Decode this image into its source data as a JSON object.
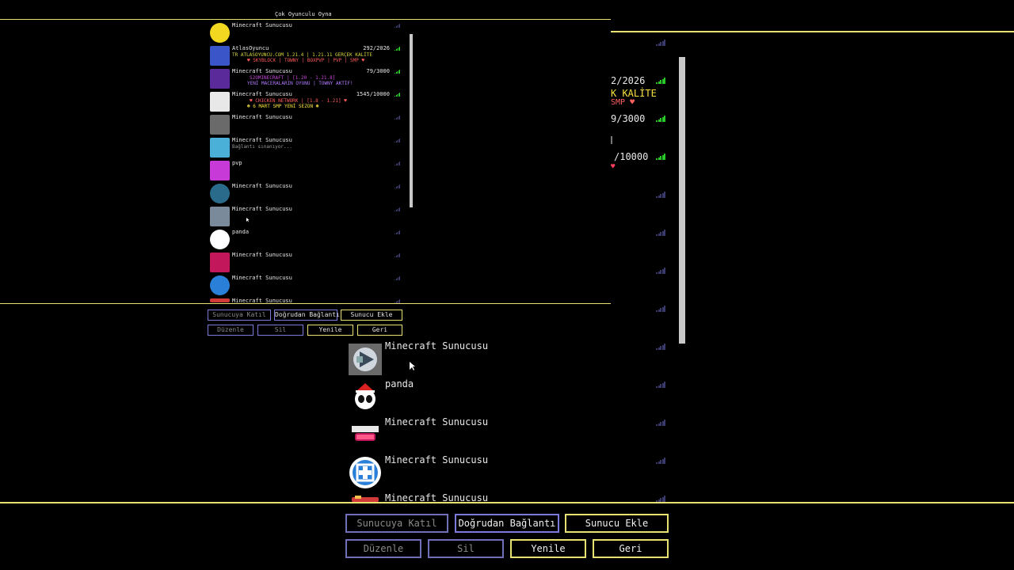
{
  "screen_title": "Çok Oyunculu Oyna",
  "servers": [
    {
      "name": "Minecraft Sunucusu",
      "icon": "yellow-face-icon"
    },
    {
      "name": "AtlasOyuncu",
      "icon": "atlas-shield-icon",
      "players": "292/2026",
      "signal": "green",
      "motd1": "TR ATLASOYUNCU.COM 1.21.4 | 1.21.11 GERÇEK KALİTE",
      "motd2": "♥ SKYBLOCK | TOWNY | BOXPVP | PVP | SMP ♥"
    },
    {
      "name": "Minecraft Sunucusu",
      "icon": "purple-mask-icon",
      "players": "79/3000",
      "signal": "green",
      "motd1": "S2OMINECRAFT | [1.20 - 1.21.8]",
      "motd2": "YENİ MACERALARIN OYUNU | TOWNY AKTİF!"
    },
    {
      "name": "Minecraft Sunucusu",
      "icon": "chicken-icon",
      "players": "1545/10000",
      "signal": "green",
      "motd1": "♥ CHICKEN NETWORK | [1.8 - 1.21] ♥",
      "motd2": "☻ 6 MART SMP YENİ SEZON ☻"
    },
    {
      "name": "Minecraft Sunucusu",
      "icon": "landscape-icon"
    },
    {
      "name": "Minecraft Sunucusu",
      "icon": "dragon-icon",
      "motd1": "Bağlantı sınanıyor..."
    },
    {
      "name": "pvp",
      "icon": "pvp-logo-icon"
    },
    {
      "name": "Minecraft Sunucusu",
      "icon": "mr-logo-icon"
    },
    {
      "name": "Minecraft Sunucusu",
      "icon": "play-arrow-icon"
    },
    {
      "name": "panda",
      "icon": "panda-icon"
    },
    {
      "name": "Minecraft Sunucusu",
      "icon": "trpvp-logo-icon"
    },
    {
      "name": "Minecraft Sunucusu",
      "icon": "blue-cross-icon"
    },
    {
      "name": "Minecraft Sunucusu",
      "icon": "red-logo-icon"
    }
  ],
  "zoom_list": [
    {
      "name": "Minecraft Sunucusu",
      "icon": "play-arrow-icon"
    },
    {
      "name": "panda",
      "icon": "panda-icon"
    },
    {
      "name": "Minecraft Sunucusu",
      "icon": "trpvp-logo-icon"
    },
    {
      "name": "Minecraft Sunucusu",
      "icon": "blue-cross-icon"
    },
    {
      "name": "Minecraft Sunucusu",
      "icon": "red-logo-icon"
    }
  ],
  "right_fragments": {
    "players1": "2/2026",
    "motd1": "K KALİTE",
    "motd1b": "SMP ♥",
    "players2": "9/3000",
    "players3": "/10000",
    "heart": "♥"
  },
  "buttons": {
    "join": "Sunucuya Katıl",
    "direct": "Doğrudan Bağlantı",
    "add": "Sunucu Ekle",
    "edit": "Düzenle",
    "delete": "Sil",
    "refresh": "Yenile",
    "back": "Geri"
  },
  "colors": {
    "separator": "#e8e070",
    "button_border": "#7a7ad8",
    "signal_green": "#27c727",
    "signal_dim": "#3a3a6a"
  }
}
